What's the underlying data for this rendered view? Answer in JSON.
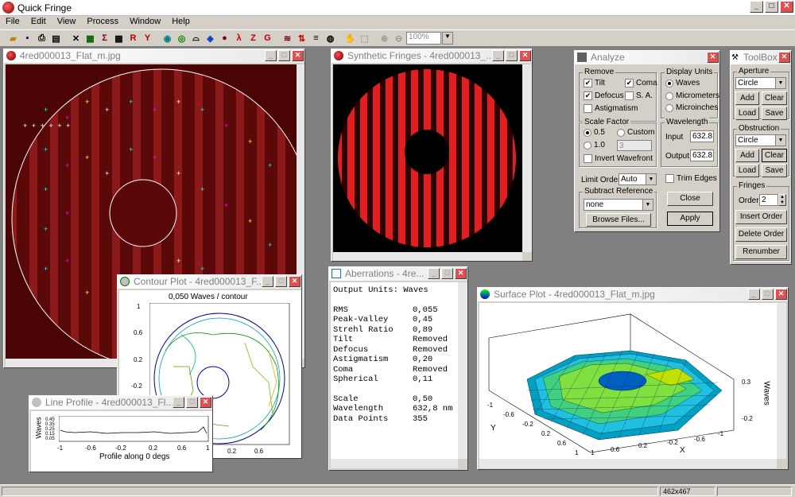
{
  "app": {
    "title": "Quick Fringe"
  },
  "menu": [
    "File",
    "Edit",
    "View",
    "Process",
    "Window",
    "Help"
  ],
  "toolbar": {
    "zoom": "100%"
  },
  "windows": {
    "interferogram": {
      "title": "4red000013_Flat_m.jpg"
    },
    "synthetic": {
      "title": "Synthetic Fringes - 4red000013_..."
    },
    "contour": {
      "title": "Contour Plot - 4red000013_F...",
      "caption": "0,050 Waves / contour",
      "yticks": [
        "1",
        "0.6",
        "0.2",
        "-0.2"
      ],
      "xticks": [
        "0.2",
        "0.6"
      ]
    },
    "lineprofile": {
      "title": "Line Profile - 4red000013_Fl...",
      "ylabel": "Waves",
      "yticks": [
        "0.45",
        "0.35",
        "0.25",
        "0.15",
        "0.05"
      ],
      "xticks": [
        "-1",
        "-0.6",
        "-0.2",
        "0.2",
        "0.6",
        "1"
      ],
      "xlabel": "Profile along 0 degs"
    },
    "aberrations": {
      "title": "Aberrations - 4re...",
      "header": "Output Units: Waves",
      "rows": [
        {
          "k": "RMS",
          "v": "0,055"
        },
        {
          "k": "Peak-Valley",
          "v": "0,45"
        },
        {
          "k": "Strehl Ratio",
          "v": "0,89"
        },
        {
          "k": "Tilt",
          "v": "Removed"
        },
        {
          "k": "Defocus",
          "v": "Removed"
        },
        {
          "k": "Astigmatism",
          "v": "0,20"
        },
        {
          "k": "Coma",
          "v": "Removed"
        },
        {
          "k": "Spherical",
          "v": "0,11"
        }
      ],
      "rows2": [
        {
          "k": "Scale",
          "v": "0,50"
        },
        {
          "k": "Wavelength",
          "v": "632,8 nm"
        },
        {
          "k": "Data Points",
          "v": "355"
        }
      ]
    },
    "surface": {
      "title": "Surface Plot - 4red000013_Flat_m.jpg",
      "zlabel": "Waves",
      "zticks": [
        "0.3",
        "-0.2"
      ],
      "yaxis": "Y",
      "xaxis": "X",
      "yticks": [
        "-1",
        "-0.6",
        "-0.2",
        "0.2",
        "0.6",
        "1"
      ],
      "xticks": [
        "1",
        "0.6",
        "0.2",
        "-0.2",
        "-0.6",
        "-1"
      ]
    },
    "analyze": {
      "title": "Analyze",
      "remove": {
        "label": "Remove",
        "tilt": "Tilt",
        "coma": "Coma",
        "defocus": "Defocus",
        "sa": "S. A.",
        "astig": "Astigmatism"
      },
      "units": {
        "label": "Display Units",
        "waves": "Waves",
        "micrometers": "Micrometers",
        "microinches": "Microinches"
      },
      "scale": {
        "label": "Scale Factor",
        "v05": "0.5",
        "custom": "Custom",
        "v10": "1.0",
        "custom_val": "3",
        "invert": "Invert Wavefront"
      },
      "wavelength": {
        "label": "Wavelength",
        "input_label": "Input",
        "input_val": "632.8",
        "output_label": "Output",
        "output_val": "632.8"
      },
      "limit_label": "Limit Order",
      "limit_val": "Auto",
      "trim": "Trim Edges",
      "subtract": {
        "label": "Subtract Reference",
        "val": "none",
        "browse": "Browse Files..."
      },
      "close": "Close",
      "apply": "Apply"
    },
    "toolbox": {
      "title": "ToolBox",
      "aperture": {
        "label": "Aperture",
        "val": "Circle",
        "add": "Add",
        "clear": "Clear",
        "load": "Load",
        "save": "Save"
      },
      "obstruction": {
        "label": "Obstruction",
        "val": "Circle",
        "add": "Add",
        "clear": "Clear",
        "load": "Load",
        "save": "Save"
      },
      "fringes": {
        "label": "Fringes",
        "order_label": "Order",
        "order_val": "2",
        "insert": "Insert Order",
        "delete": "Delete Order",
        "renumber": "Renumber"
      }
    }
  },
  "status": {
    "size": "462x467"
  }
}
